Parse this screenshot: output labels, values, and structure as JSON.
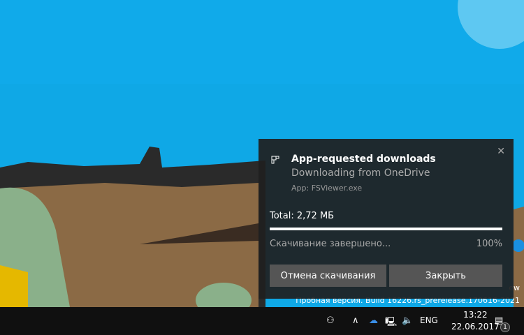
{
  "toast": {
    "app_icon": "download-app-icon",
    "title": "App-requested downloads",
    "subtitle": "Downloading from OneDrive",
    "app": "App: FSViewer.exe",
    "total": "Total: 2,72 МБ",
    "progress_percent": 100,
    "status": "Скачивание завершено...",
    "percent_label": "100%",
    "cancel_label": "Отмена скачивания",
    "close_label": "Закрыть"
  },
  "watermark": {
    "line1_partial": "ew",
    "line2": "Пробная версия. Build 16226.rs_prerelease.170616-2021"
  },
  "taskbar": {
    "language": "ENG",
    "time": "13:22",
    "date": "22.06.2017",
    "notification_count": "1"
  },
  "colors": {
    "sky": "#0fa8e6",
    "sand": "#8b6a45",
    "toast_bg": "#1f1f1f",
    "button": "#555555"
  }
}
